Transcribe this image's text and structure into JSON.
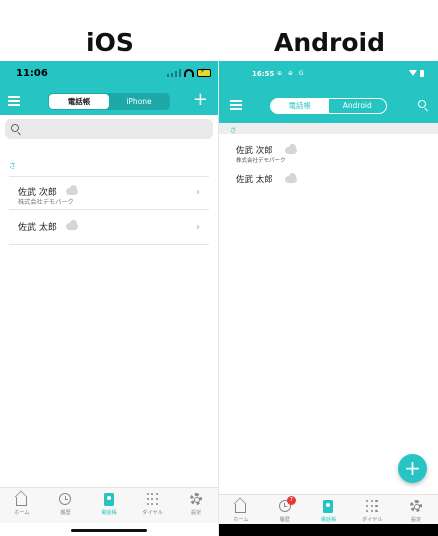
{
  "titles": {
    "ios": "iOS",
    "android": "Android"
  },
  "ios": {
    "status_time": "11:06",
    "segment": {
      "left": "電話帳",
      "right": "iPhone",
      "selected": "left"
    },
    "index_letter": "さ",
    "contacts": [
      {
        "name": "佐武 次郎",
        "company": "株式会社デモパーク"
      },
      {
        "name": "佐武 太郎",
        "company": ""
      }
    ],
    "tabs": [
      {
        "label": "ホーム",
        "icon": "home-icon"
      },
      {
        "label": "履歴",
        "icon": "history-icon"
      },
      {
        "label": "電話帳",
        "icon": "phonebook-icon",
        "active": true
      },
      {
        "label": "ダイヤル",
        "icon": "dialpad-icon"
      },
      {
        "label": "設定",
        "icon": "settings-icon"
      }
    ]
  },
  "android": {
    "status_time": "16:55",
    "status_icons": "⊕ ⊕ G",
    "segment": {
      "left": "電話帳",
      "right": "Android",
      "selected": "left"
    },
    "index_letter": "さ",
    "contacts": [
      {
        "name": "佐武 次郎",
        "company": "株式会社デモパーク"
      },
      {
        "name": "佐武 太郎",
        "company": ""
      }
    ],
    "history_badge": "7",
    "tabs": [
      {
        "label": "ホーム",
        "icon": "home-icon"
      },
      {
        "label": "履歴",
        "icon": "history-icon"
      },
      {
        "label": "電話帳",
        "icon": "phonebook-icon",
        "active": true
      },
      {
        "label": "ダイヤル",
        "icon": "dialpad-icon"
      },
      {
        "label": "設定",
        "icon": "settings-icon"
      }
    ]
  },
  "colors": {
    "accent": "#27c4c4",
    "badge": "#e53935"
  }
}
